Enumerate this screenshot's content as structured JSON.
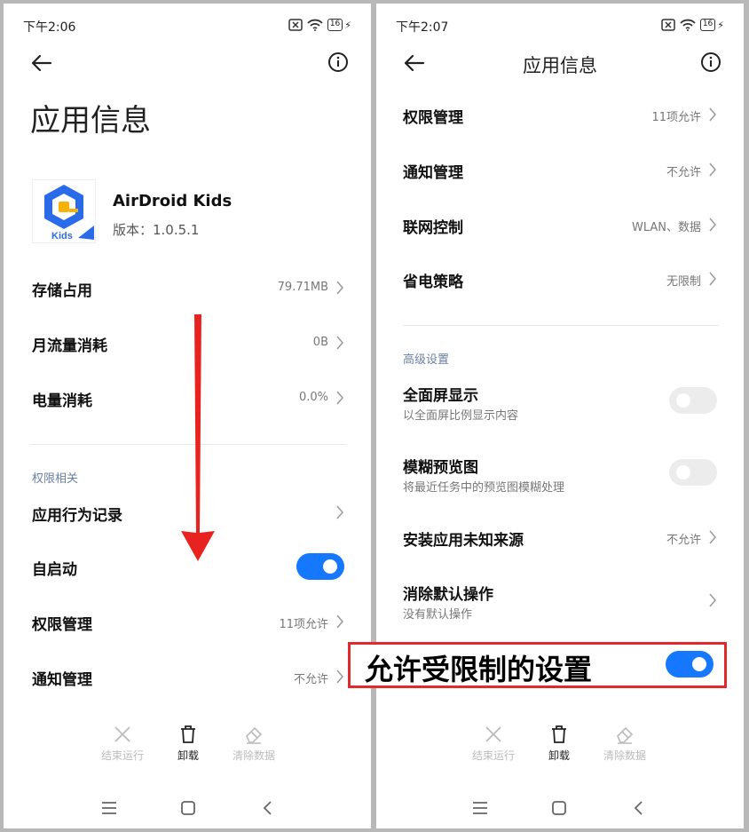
{
  "left": {
    "status": {
      "time": "下午2:06",
      "battery": "16"
    },
    "title": "应用信息",
    "app": {
      "name": "AirDroid Kids",
      "version": "版本：1.0.5.1",
      "icon_text": "Kids"
    },
    "rows": {
      "storage": {
        "label": "存储占用",
        "value": "79.71MB"
      },
      "traffic": {
        "label": "月流量消耗",
        "value": "0B"
      },
      "power": {
        "label": "电量消耗",
        "value": "0.0%"
      }
    },
    "section": "权限相关",
    "perm_rows": {
      "behavior": {
        "label": "应用行为记录",
        "value": ""
      },
      "autostart": {
        "label": "自启动",
        "toggle": true
      },
      "permissions": {
        "label": "权限管理",
        "value": "11项允许"
      },
      "notification": {
        "label": "通知管理",
        "value": "不允许"
      }
    },
    "actions": {
      "stop": "结束运行",
      "uninstall": "卸载",
      "clear": "清除数据"
    }
  },
  "right": {
    "status": {
      "time": "下午2:07",
      "battery": "16"
    },
    "title": "应用信息",
    "rows": {
      "permissions": {
        "label": "权限管理",
        "value": "11项允许"
      },
      "notification": {
        "label": "通知管理",
        "value": "不允许"
      },
      "network": {
        "label": "联网控制",
        "value": "WLAN、数据"
      },
      "battery_saver": {
        "label": "省电策略",
        "value": "无限制"
      }
    },
    "section": "高级设置",
    "adv_rows": {
      "fullscreen": {
        "label": "全面屏显示",
        "sub": "以全面屏比例显示内容",
        "toggle": false
      },
      "blur": {
        "label": "模糊预览图",
        "sub": "将最近任务中的预览图模糊处理",
        "toggle": false
      },
      "unknown_sources": {
        "label": "安装应用未知来源",
        "value": "不允许"
      },
      "clear_defaults": {
        "label": "消除默认操作",
        "sub": "没有默认操作"
      }
    },
    "highlight": {
      "label": "允许受限制的设置",
      "toggle": true
    },
    "actions": {
      "stop": "结束运行",
      "uninstall": "卸载",
      "clear": "清除数据"
    }
  },
  "colors": {
    "accent": "#1677ff",
    "highlight_border": "#e12a2a",
    "arrow": "#e8231f"
  }
}
